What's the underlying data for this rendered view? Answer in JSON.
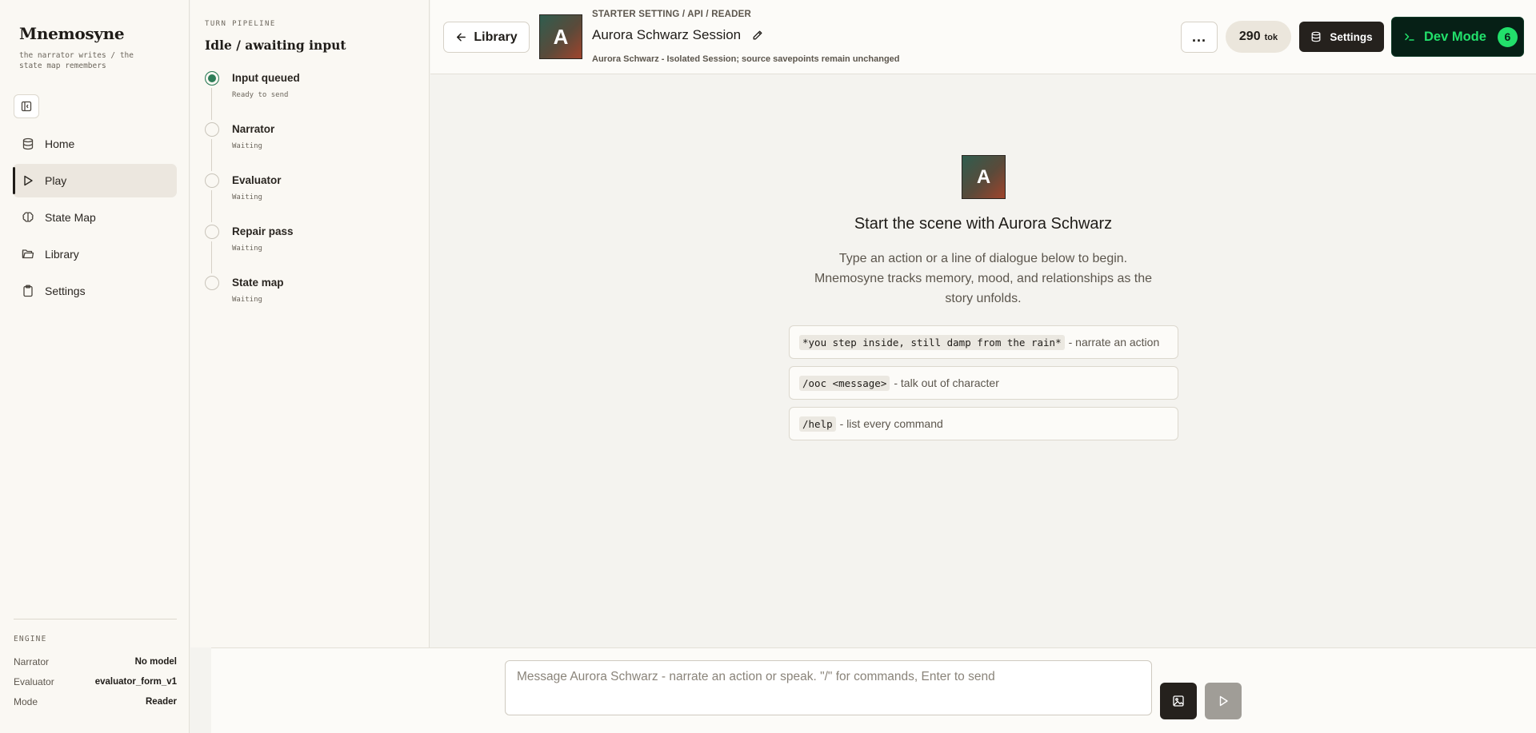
{
  "app": {
    "name": "Mnemosyne",
    "tagline": "the narrator writes / the state map remembers"
  },
  "nav": [
    {
      "label": "Home",
      "icon": "database-icon"
    },
    {
      "label": "Play",
      "icon": "play-icon",
      "active": true
    },
    {
      "label": "State Map",
      "icon": "brain-icon"
    },
    {
      "label": "Library",
      "icon": "folder-icon"
    },
    {
      "label": "Settings",
      "icon": "clipboard-icon"
    }
  ],
  "engine": {
    "title": "ENGINE",
    "rows": [
      {
        "key": "Narrator",
        "value": "No model"
      },
      {
        "key": "Evaluator",
        "value": "evaluator_form_v1"
      },
      {
        "key": "Mode",
        "value": "Reader"
      }
    ]
  },
  "pipeline": {
    "label": "TURN PIPELINE",
    "state": "Idle / awaiting input",
    "steps": [
      {
        "name": "Input queued",
        "status": "Ready to send",
        "active": true
      },
      {
        "name": "Narrator",
        "status": "Waiting"
      },
      {
        "name": "Evaluator",
        "status": "Waiting"
      },
      {
        "name": "Repair pass",
        "status": "Waiting"
      },
      {
        "name": "State map",
        "status": "Waiting"
      }
    ]
  },
  "header": {
    "back_label": "Library",
    "avatar_letter": "A",
    "breadcrumb": "STARTER SETTING / API / READER",
    "title": "Aurora Schwarz Session",
    "subtitle": "Aurora Schwarz - Isolated Session; source savepoints remain unchanged",
    "more_label": "...",
    "tokens": "290",
    "tokens_unit": "tok",
    "settings_label": "Settings",
    "dev_label": "Dev Mode",
    "dev_count": "6",
    "colors": {
      "dev_bg": "#062016",
      "dev_accent": "#22e06b",
      "dark_button": "#25211d"
    }
  },
  "main": {
    "avatar_letter": "A",
    "title": "Start the scene with Aurora Schwarz",
    "description": "Type an action or a line of dialogue below to begin. Mnemosyne tracks memory, mood, and relationships as the story unfolds.",
    "hints": [
      {
        "code": "*you step inside, still damp from the rain*",
        "text": "- narrate an action"
      },
      {
        "code": "/ooc <message>",
        "text": "- talk out of character"
      },
      {
        "code": "/help",
        "text": "- list every command"
      }
    ]
  },
  "composer": {
    "placeholder": "Message Aurora Schwarz - narrate an action or speak. \"/\" for commands, Enter to send",
    "value": ""
  }
}
